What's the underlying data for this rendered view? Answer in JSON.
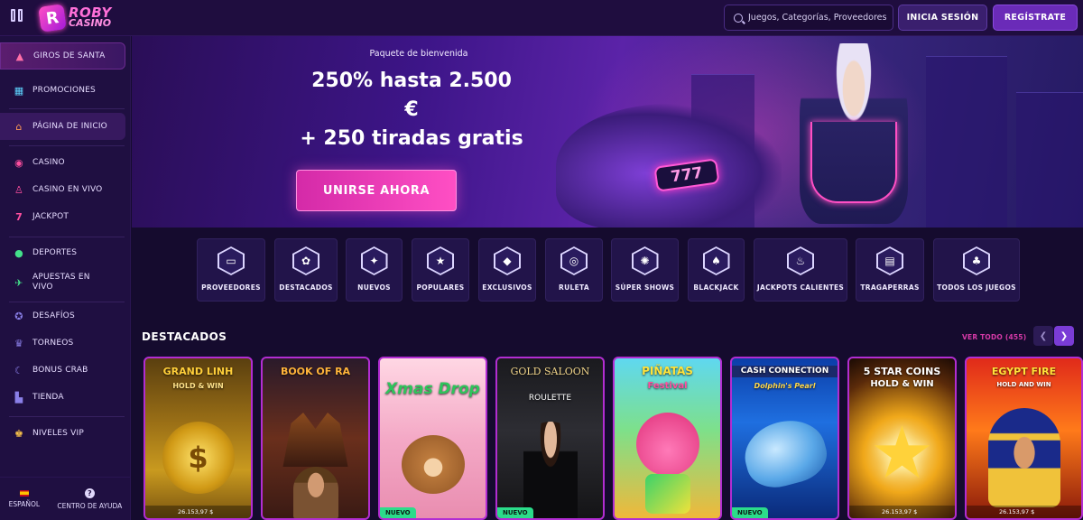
{
  "header": {
    "logo_line1": "ROBY",
    "logo_line2": "CASINO",
    "search_placeholder": "Juegos, Categorías, Proveedores",
    "login_label": "INICIA SESIÓN",
    "register_label": "REGÍSTRATE"
  },
  "sidebar": {
    "items": [
      {
        "label": "GIROS DE SANTA",
        "icon": "tree-icon"
      },
      {
        "label": "PROMOCIONES",
        "icon": "gift-icon"
      },
      {
        "label": "PÁGINA DE INICIO",
        "icon": "home-icon"
      },
      {
        "label": "CASINO",
        "icon": "chip-icon"
      },
      {
        "label": "CASINO EN VIVO",
        "icon": "live-icon"
      },
      {
        "label": "JACKPOT",
        "icon": "seven-icon"
      },
      {
        "label": "DEPORTES",
        "icon": "ball-icon"
      },
      {
        "label": "APUESTAS EN VIVO",
        "icon": "ticket-icon"
      },
      {
        "label": "DESAFÍOS",
        "icon": "medal-icon"
      },
      {
        "label": "TORNEOS",
        "icon": "trophy-icon"
      },
      {
        "label": "BONUS CRAB",
        "icon": "crab-icon"
      },
      {
        "label": "TIENDA",
        "icon": "cart-icon"
      },
      {
        "label": "NIVELES VIP",
        "icon": "crown-icon"
      }
    ],
    "footer": {
      "language_label": "ESPAÑOL",
      "help_label": "CENTRO DE AYUDA"
    }
  },
  "hero": {
    "eyebrow": "Paquete de bienvenida",
    "title_line1": "250% hasta 2.500",
    "title_line2": "€",
    "title_line3": "+ 250 tiradas gratis",
    "cta_label": "UNIRSE AHORA",
    "bike_display": "777"
  },
  "categories": [
    {
      "label": "PROVEEDORES",
      "icon": "folder-icon"
    },
    {
      "label": "DESTACADOS",
      "icon": "badge-icon"
    },
    {
      "label": "NUEVOS",
      "icon": "sparkle-icon"
    },
    {
      "label": "POPULARES",
      "icon": "star-icon"
    },
    {
      "label": "EXCLUSIVOS",
      "icon": "diamond-icon"
    },
    {
      "label": "RULETA",
      "icon": "roulette-icon"
    },
    {
      "label": "SÚPER SHOWS",
      "icon": "wheel-icon"
    },
    {
      "label": "BLACKJACK",
      "icon": "spade-icon"
    },
    {
      "label": "JACKPOTS CALIENTES",
      "icon": "flame-icon"
    },
    {
      "label": "TRAGAPERRAS",
      "icon": "slot-icon"
    },
    {
      "label": "TODOS LOS JUEGOS",
      "icon": "cherry-icon"
    }
  ],
  "featured": {
    "title": "DESTACADOS",
    "see_all": "VER TODO (455)",
    "games": [
      {
        "title": "GRAND LINH",
        "subtitle": "HOLD & WIN",
        "jackpot": "26.153,97 $",
        "badge": ""
      },
      {
        "title": "BOOK OF RA",
        "subtitle": "",
        "jackpot": "",
        "badge": ""
      },
      {
        "title": "Xmas Drop",
        "subtitle": "",
        "jackpot": "",
        "badge": "NUEVO"
      },
      {
        "title": "GOLD SALOON",
        "subtitle": "ROULETTE",
        "jackpot": "",
        "badge": "NUEVO"
      },
      {
        "title": "PIÑATAS",
        "subtitle": "Festival",
        "jackpot": "",
        "badge": ""
      },
      {
        "title": "CASH CONNECTION",
        "subtitle": "Dolphin's Pearl",
        "jackpot": "",
        "badge": "NUEVO"
      },
      {
        "title": "5 STAR COINS",
        "subtitle": "HOLD & WIN",
        "jackpot": "26.153,97 $",
        "badge": ""
      },
      {
        "title": "EGYPT FIRE",
        "subtitle": "HOLD AND WIN",
        "jackpot": "26.153,97 $",
        "badge": ""
      }
    ]
  },
  "colors": {
    "accent_pink": "#ff4fc4",
    "accent_purple": "#7a3cd6",
    "background": "#150b2e",
    "new_badge": "#2bdc8a"
  }
}
